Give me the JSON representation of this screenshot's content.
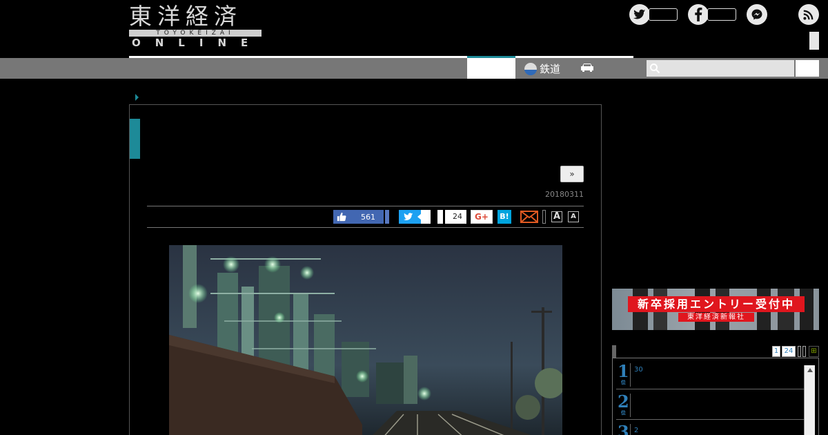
{
  "header": {
    "logo_kanji": "東洋経済",
    "logo_sub": "TOYOKEIZAI",
    "logo_online": "ONLINE"
  },
  "social": {
    "twitter_icon": "twitter-icon",
    "facebook_icon": "facebook-icon",
    "messenger_icon": "messenger-icon",
    "rss_icon": "rss-icon"
  },
  "nav": {
    "rail_label": "鉄道"
  },
  "article": {
    "next_label": "»",
    "date": "20180311"
  },
  "share": {
    "facebook_count": "561",
    "hatena_count": "24",
    "gplus_label": "G+",
    "hatena_label": "B!",
    "font_large": "A",
    "font_small": "A"
  },
  "sidebar": {
    "banner_title": "新卒採用エントリー受付中",
    "banner_sub": "東洋経済新報社",
    "tabs": [
      "1",
      "24"
    ],
    "ranking": [
      {
        "rank": "1",
        "unit": "位",
        "text": "30"
      },
      {
        "rank": "2",
        "unit": "位",
        "text": ""
      },
      {
        "rank": "3",
        "unit": "位",
        "text": "2"
      }
    ]
  }
}
